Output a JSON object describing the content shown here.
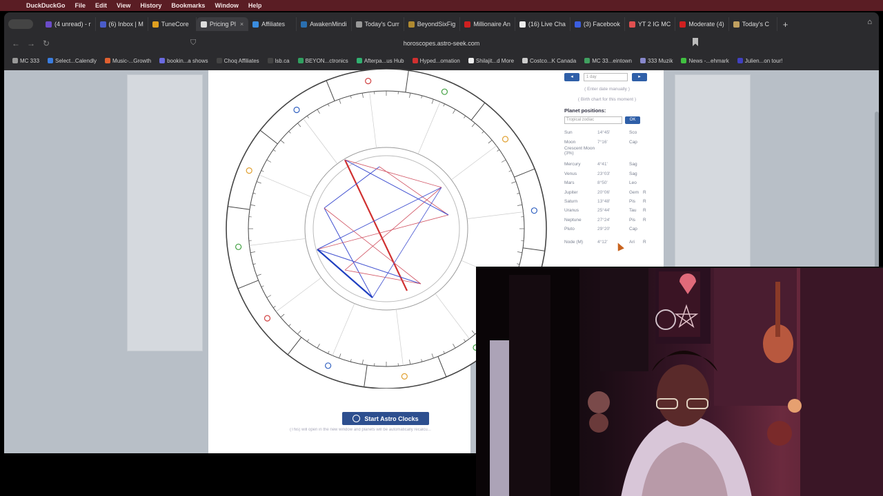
{
  "menubar": {
    "app": "DuckDuckGo",
    "items": [
      "File",
      "Edit",
      "View",
      "History",
      "Bookmarks",
      "Window",
      "Help"
    ]
  },
  "tabs": [
    {
      "label": "(4 unread) - r",
      "color": "#6b4cc9"
    },
    {
      "label": "(6) Inbox | M",
      "color": "#4a5cc9"
    },
    {
      "label": "TuneCore",
      "color": "#e0a020"
    },
    {
      "label": "Pricing Pl",
      "color": "#dddddd",
      "active": true
    },
    {
      "label": "Affiliates",
      "color": "#3a8de0"
    },
    {
      "label": "AwakenMindi",
      "color": "#2a6fb0"
    },
    {
      "label": "Today's Curr",
      "color": "#999999"
    },
    {
      "label": "BeyondSixFig",
      "color": "#b08a30"
    },
    {
      "label": "Millionaire An",
      "color": "#d02020"
    },
    {
      "label": "(16) Live Cha",
      "color": "#eeeeee"
    },
    {
      "label": "(3) Facebook",
      "color": "#3b5ee0"
    },
    {
      "label": "YT 2 IG MC",
      "color": "#e05050"
    },
    {
      "label": "Moderate (4)",
      "color": "#d02020"
    },
    {
      "label": "Today's C",
      "color": "#c0a060"
    }
  ],
  "navbar": {
    "url": "horoscopes.astro-seek.com"
  },
  "bookmarks": [
    {
      "label": "MC 333",
      "color": "#999999"
    },
    {
      "label": "Select...Calendly",
      "color": "#3a7de0"
    },
    {
      "label": "Music-...Growth",
      "color": "#e06030"
    },
    {
      "label": "bookin...a shows",
      "color": "#6a6ae0"
    },
    {
      "label": "Choq Affiliates",
      "color": "#444444"
    },
    {
      "label": "lsb.ca",
      "color": "#444444"
    },
    {
      "label": "BEYON...ctronics",
      "color": "#30a060"
    },
    {
      "label": "Afterpa...us Hub",
      "color": "#30b070"
    },
    {
      "label": "Hyped...omation",
      "color": "#d03030"
    },
    {
      "label": "Shilajit...d More",
      "color": "#eeeeee"
    },
    {
      "label": "Costco...K Canada",
      "color": "#cccccc"
    },
    {
      "label": "MC 33...eintown",
      "color": "#40a060"
    },
    {
      "label": "333 Muzik",
      "color": "#8888cc"
    },
    {
      "label": "News -...ehmark",
      "color": "#40c040"
    },
    {
      "label": "Julien...on tour!",
      "color": "#4040c0"
    }
  ],
  "panel": {
    "prev": "◂",
    "next": "▸",
    "period": "1 day",
    "enter_date": "( Enter date manually )",
    "birth_chart": "( Birth chart for this moment )",
    "heading": "Planet positions:",
    "zodiac": "Tropical zodiac",
    "ok": "OK",
    "planets": [
      {
        "name": "Sun",
        "pos": "14°45'",
        "sign": "Sco",
        "r": ""
      },
      {
        "name": "Moon",
        "pos": "7°16'",
        "sign": "Cap",
        "r": ""
      },
      {
        "name": "Crescent Moon (3%)",
        "pos": "",
        "sign": "",
        "r": ""
      },
      {
        "name": "Mercury",
        "pos": "4°41'",
        "sign": "Sag",
        "r": "",
        "gap": true
      },
      {
        "name": "Venus",
        "pos": "23°03'",
        "sign": "Sag",
        "r": ""
      },
      {
        "name": "Mars",
        "pos": "8°50'",
        "sign": "Leo",
        "r": ""
      },
      {
        "name": "Jupiter",
        "pos": "20°06'",
        "sign": "Gem",
        "r": "R"
      },
      {
        "name": "Saturn",
        "pos": "13°48'",
        "sign": "Pis",
        "r": "R"
      },
      {
        "name": "Uranus",
        "pos": "25°44'",
        "sign": "Tau",
        "r": "R"
      },
      {
        "name": "Neptune",
        "pos": "27°24'",
        "sign": "Pis",
        "r": "R"
      },
      {
        "name": "Pluto",
        "pos": "29°20'",
        "sign": "Cap",
        "r": ""
      },
      {
        "name": "Node (M)",
        "pos": "4°12'",
        "sign": "Ari",
        "r": "R",
        "gap": true
      }
    ]
  },
  "cta": {
    "label": "Start Astro Clocks",
    "note": "(This) will open in the new window and planets will be automatically recalcu..."
  },
  "colors": {
    "cta": "#2d4f8f",
    "accent": "#2f5fa8",
    "menubar": "#5a1d24"
  }
}
